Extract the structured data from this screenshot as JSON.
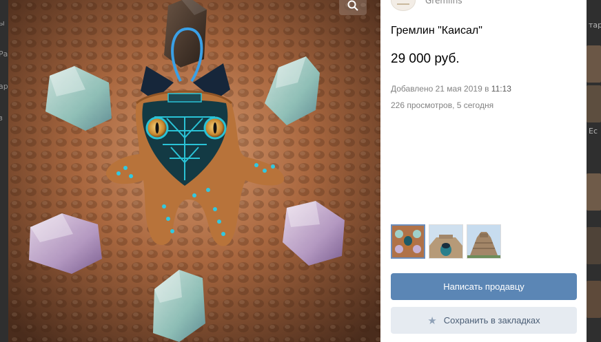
{
  "background": {
    "left_fragments": [
      "ы",
      "Ра",
      "ар",
      "з"
    ],
    "right_fragments": [
      "тар",
      "Ес"
    ]
  },
  "viewer": {
    "zoom_icon": "magnifier-icon",
    "photo_subject": "handmade gremlin toy among crystals"
  },
  "seller": {
    "name": "Gremlins"
  },
  "product": {
    "title": "Гремлин \"Каисал\"",
    "price": "29 000 руб.",
    "added_prefix": "Добавлено 21 мая 2019 в ",
    "added_time": "11:13",
    "views": "226 просмотров, 5 сегодня"
  },
  "thumbnails": [
    {
      "name": "photo-thumb-1",
      "active": true
    },
    {
      "name": "photo-thumb-2",
      "active": false
    },
    {
      "name": "photo-thumb-3",
      "active": false
    }
  ],
  "actions": {
    "message_seller": "Написать продавцу",
    "save_bookmark": "Сохранить в закладках",
    "bookmark_icon": "star-icon"
  },
  "colors": {
    "primary_button": "#5b86b5",
    "secondary_button": "#e6ebf1",
    "meta_text": "#828282"
  }
}
